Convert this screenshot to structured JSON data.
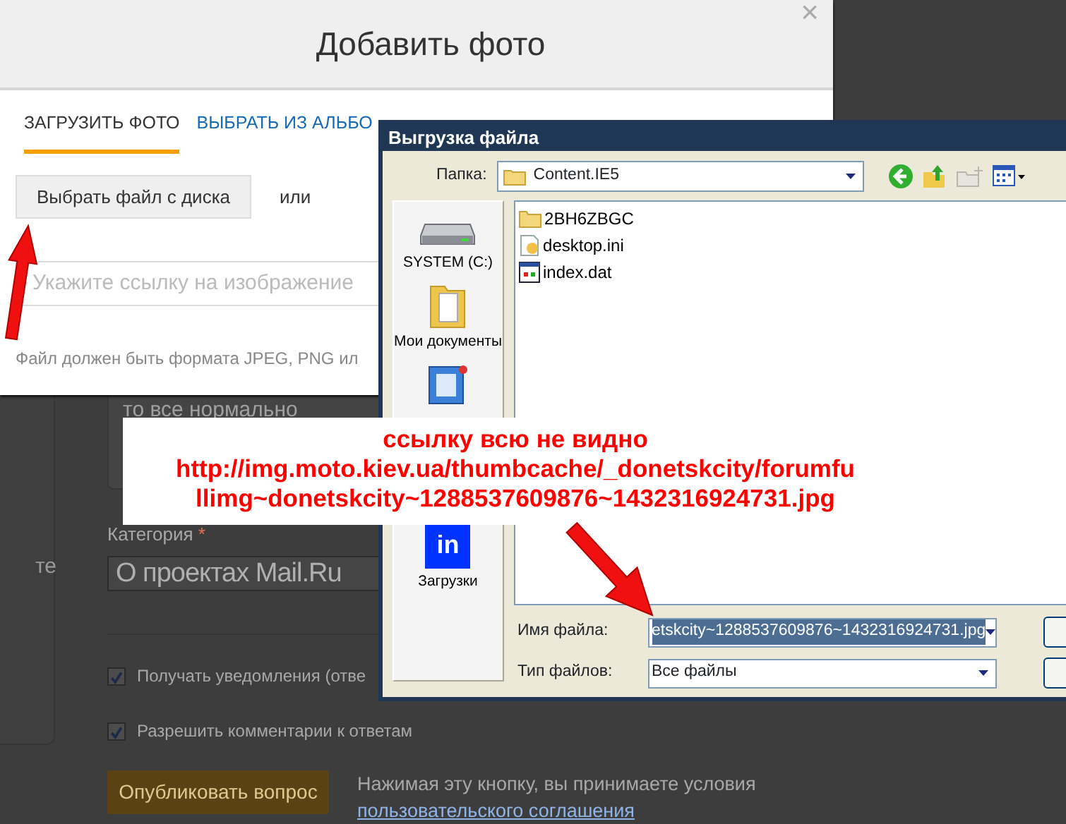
{
  "page": {
    "sidebar_fragment": "те",
    "preview_text": "то все нормально",
    "category_label": "Категория",
    "required_mark": "*",
    "category_value": "О проектах Mail.Ru",
    "options": [
      {
        "label": "Получать уведомления (отве",
        "checked": true
      },
      {
        "label": "Разрешить комментарии к ответам",
        "checked": true
      }
    ],
    "publish_button": "Опубликовать вопрос",
    "terms_text": "Нажимая эту кнопку, вы принимаете условия",
    "terms_link": "пользовательского соглашения"
  },
  "modal": {
    "title": "Добавить фото",
    "close": "×",
    "tabs": [
      {
        "label": "ЗАГРУЗИТЬ ФОТО",
        "selected": true
      },
      {
        "label": "ВЫБРАТЬ ИЗ АЛЬБО",
        "selected": false
      }
    ],
    "upload_button": "Выбрать файл с диска",
    "or_text": "или",
    "url_field": {
      "placeholder": "Укажите ссылку на изображение"
    },
    "hint": "Файл должен быть формата JPEG, PNG ил"
  },
  "file_dialog": {
    "title": "Выгрузка файла",
    "folder_label": "Папка:",
    "folder": "Content.IE5",
    "places": [
      {
        "kind": "drive",
        "label": "SYSTEM (C:)"
      },
      {
        "kind": "documents",
        "label": "Мои документы"
      },
      {
        "kind": "computer"
      },
      {
        "kind": "downloads",
        "icon_text": "in",
        "label": "Загрузки"
      }
    ],
    "files": [
      {
        "kind": "folder",
        "name": "2BH6ZBGC"
      },
      {
        "kind": "settings",
        "name": "desktop.ini"
      },
      {
        "kind": "data",
        "name": "index.dat"
      }
    ],
    "filename_label": "Имя файла:",
    "filename": "etskcity~1288537609876~1432316924731.jpg",
    "filetype_label": "Тип файлов:",
    "filetype": "Все файлы"
  },
  "annotation": {
    "lines": [
      "ссылку всю не видно",
      "http://img.moto.kiev.ua/thumbcache/_donetskcity/forumfu",
      "llimg~donetskcity~1288537609876~1432316924731.jpg"
    ]
  }
}
